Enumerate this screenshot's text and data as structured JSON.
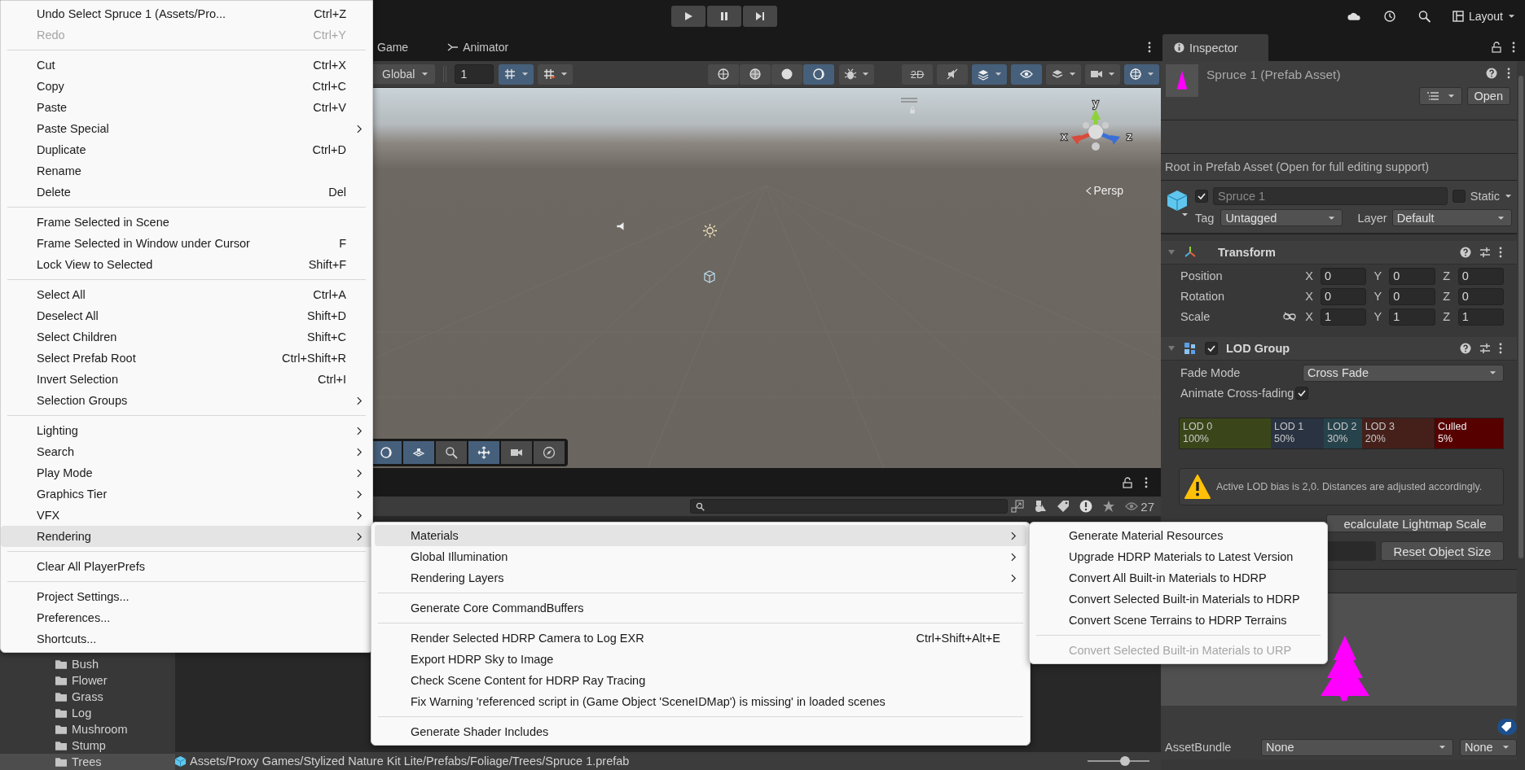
{
  "top_bar": {
    "layout_label": "Layout"
  },
  "scene_tabs": [
    {
      "label": "Game"
    },
    {
      "label": "Animator"
    }
  ],
  "scene_toolbar": {
    "pivot_label": "Global",
    "grid_value": "1",
    "groups": [
      [
        {
          "kind": "grid",
          "on": true
        },
        {
          "kind": "snap",
          "on": false
        }
      ],
      [
        {
          "kind": "wire",
          "on": false
        },
        {
          "kind": "shaded-wire",
          "on": false
        },
        {
          "kind": "shaded",
          "on": false
        },
        {
          "kind": "unlit",
          "on": true
        }
      ],
      [
        {
          "kind": "debug",
          "on": false
        }
      ],
      [
        {
          "kind": "flat",
          "on": false,
          "label": "2D"
        },
        {
          "kind": "audio",
          "on": false
        },
        {
          "kind": "effects",
          "on": true
        },
        {
          "kind": "visibility",
          "on": true
        },
        {
          "kind": "layers",
          "on": false
        },
        {
          "kind": "camera",
          "on": false
        },
        {
          "kind": "gizmos",
          "on": true
        }
      ]
    ]
  },
  "scene_view": {
    "camera_label": "Persp",
    "axes": [
      "y",
      "x",
      "z"
    ],
    "overlay_tools": [
      {
        "kind": "unlit",
        "on": true
      },
      {
        "kind": "tiles",
        "on": true
      },
      {
        "kind": "search",
        "on": false
      },
      {
        "kind": "move",
        "on": true
      },
      {
        "kind": "camera",
        "on": false
      },
      {
        "kind": "compass",
        "on": false
      }
    ]
  },
  "project": {
    "count": "27",
    "folders": [
      {
        "label": "Bush",
        "selected": false
      },
      {
        "label": "Flower",
        "selected": false
      },
      {
        "label": "Grass",
        "selected": false
      },
      {
        "label": "Log",
        "selected": false
      },
      {
        "label": "Mushroom",
        "selected": false
      },
      {
        "label": "Stump",
        "selected": false
      },
      {
        "label": "Trees",
        "selected": true
      }
    ],
    "path": "Assets/Proxy Games/Stylized Nature Kit Lite/Prefabs/Foliage/Trees/Spruce 1.prefab",
    "zoom_slider": {
      "level": 0.6
    }
  },
  "inspector": {
    "tab": "Inspector",
    "asset_title": "Spruce 1 (Prefab Asset)",
    "open_button": "Open",
    "notice": "Root in Prefab Asset (Open for full editing support)",
    "object": {
      "active": true,
      "name": "Spruce 1",
      "static": false,
      "static_label": "Static",
      "tag_label": "Tag",
      "tag": "Untagged",
      "layer_label": "Layer",
      "layer": "Default"
    },
    "transform": {
      "title": "Transform",
      "rows": [
        {
          "label": "Position",
          "values": [
            {
              "axis": "X",
              "value": "0"
            },
            {
              "axis": "Y",
              "value": "0"
            },
            {
              "axis": "Z",
              "value": "0"
            }
          ]
        },
        {
          "label": "Rotation",
          "values": [
            {
              "axis": "X",
              "value": "0"
            },
            {
              "axis": "Y",
              "value": "0"
            },
            {
              "axis": "Z",
              "value": "0"
            }
          ]
        },
        {
          "label": "Scale",
          "values": [
            {
              "axis": "X",
              "value": "1"
            },
            {
              "axis": "Y",
              "value": "1"
            },
            {
              "axis": "Z",
              "value": "1"
            }
          ]
        }
      ]
    },
    "lod_group": {
      "title": "LOD Group",
      "enabled": true,
      "fade_mode_label": "Fade Mode",
      "fade_mode": "Cross Fade",
      "animate_label": "Animate Cross-fading",
      "animate": true,
      "levels": [
        {
          "name": "LOD 0",
          "percent": "100%",
          "color": "#3a4619"
        },
        {
          "name": "LOD 1",
          "percent": "50%",
          "color": "#2a3342"
        },
        {
          "name": "LOD 2",
          "percent": "30%",
          "color": "#26424b"
        },
        {
          "name": "LOD 3",
          "percent": "20%",
          "color": "#45201a"
        },
        {
          "name": "Culled",
          "percent": "5%",
          "color": "#560000"
        }
      ],
      "warning": "Active LOD bias is 2,0. Distances are adjusted accordingly.",
      "recalculate_button": "ecalculate Lightmap Scale",
      "reset_button": "Reset Object Size"
    },
    "asset_bundle": {
      "label": "AssetBundle",
      "name": "None",
      "variant": "None"
    }
  },
  "menus": [
    {
      "items": [
        {
          "kind": "item",
          "label": "Undo Select Spruce 1 (Assets/Pro...",
          "shortcut": "Ctrl+Z",
          "disabled": false,
          "selected": false
        },
        {
          "kind": "item",
          "label": "Redo",
          "shortcut": "Ctrl+Y",
          "disabled": true,
          "selected": false
        },
        {
          "kind": "separator"
        },
        {
          "kind": "item",
          "label": "Cut",
          "shortcut": "Ctrl+X",
          "disabled": false,
          "selected": false
        },
        {
          "kind": "item",
          "label": "Copy",
          "shortcut": "Ctrl+C",
          "disabled": false,
          "selected": false
        },
        {
          "kind": "item",
          "label": "Paste",
          "shortcut": "Ctrl+V",
          "disabled": false,
          "selected": false
        },
        {
          "kind": "submenu",
          "label": "Paste Special",
          "disabled": false,
          "selected": false
        },
        {
          "kind": "item",
          "label": "Duplicate",
          "shortcut": "Ctrl+D",
          "disabled": false,
          "selected": false
        },
        {
          "kind": "item",
          "label": "Rename",
          "disabled": false,
          "selected": false
        },
        {
          "kind": "item",
          "label": "Delete",
          "shortcut": "Del",
          "disabled": false,
          "selected": false
        },
        {
          "kind": "separator"
        },
        {
          "kind": "item",
          "label": "Frame Selected in Scene",
          "disabled": false,
          "selected": false
        },
        {
          "kind": "item",
          "label": "Frame Selected in Window under Cursor",
          "shortcut": "F",
          "disabled": false,
          "selected": false
        },
        {
          "kind": "item",
          "label": "Lock View to Selected",
          "shortcut": "Shift+F",
          "disabled": false,
          "selected": false
        },
        {
          "kind": "separator"
        },
        {
          "kind": "item",
          "label": "Select All",
          "shortcut": "Ctrl+A",
          "disabled": false,
          "selected": false
        },
        {
          "kind": "item",
          "label": "Deselect All",
          "shortcut": "Shift+D",
          "disabled": false,
          "selected": false
        },
        {
          "kind": "item",
          "label": "Select Children",
          "shortcut": "Shift+C",
          "disabled": false,
          "selected": false
        },
        {
          "kind": "item",
          "label": "Select Prefab Root",
          "shortcut": "Ctrl+Shift+R",
          "disabled": false,
          "selected": false
        },
        {
          "kind": "item",
          "label": "Invert Selection",
          "shortcut": "Ctrl+I",
          "disabled": false,
          "selected": false
        },
        {
          "kind": "submenu",
          "label": "Selection Groups",
          "disabled": false,
          "selected": false
        },
        {
          "kind": "separator"
        },
        {
          "kind": "submenu",
          "label": "Lighting",
          "disabled": false,
          "selected": false
        },
        {
          "kind": "submenu",
          "label": "Search",
          "disabled": false,
          "selected": false
        },
        {
          "kind": "submenu",
          "label": "Play Mode",
          "disabled": false,
          "selected": false
        },
        {
          "kind": "submenu",
          "label": "Graphics Tier",
          "disabled": false,
          "selected": false
        },
        {
          "kind": "submenu",
          "label": "VFX",
          "disabled": false,
          "selected": false
        },
        {
          "kind": "submenu",
          "label": "Rendering",
          "disabled": false,
          "selected": true
        },
        {
          "kind": "separator"
        },
        {
          "kind": "item",
          "label": "Clear All PlayerPrefs",
          "disabled": false,
          "selected": false
        },
        {
          "kind": "separator"
        },
        {
          "kind": "item",
          "label": "Project Settings...",
          "disabled": false,
          "selected": false
        },
        {
          "kind": "item",
          "label": "Preferences...",
          "disabled": false,
          "selected": false
        },
        {
          "kind": "item",
          "label": "Shortcuts...",
          "disabled": false,
          "selected": false
        }
      ]
    },
    {
      "items": [
        {
          "kind": "submenu",
          "label": "Materials",
          "disabled": false,
          "selected": true
        },
        {
          "kind": "submenu",
          "label": "Global Illumination",
          "disabled": false,
          "selected": false
        },
        {
          "kind": "submenu",
          "label": "Rendering Layers",
          "disabled": false,
          "selected": false
        },
        {
          "kind": "separator"
        },
        {
          "kind": "item",
          "label": "Generate Core CommandBuffers",
          "disabled": false,
          "selected": false
        },
        {
          "kind": "separator"
        },
        {
          "kind": "item",
          "label": "Render Selected HDRP Camera to Log EXR",
          "shortcut": "Ctrl+Shift+Alt+E",
          "disabled": false,
          "selected": false
        },
        {
          "kind": "item",
          "label": "Export HDRP Sky to Image",
          "disabled": false,
          "selected": false
        },
        {
          "kind": "item",
          "label": "Check Scene Content for HDRP Ray Tracing",
          "disabled": false,
          "selected": false
        },
        {
          "kind": "item",
          "label": "Fix Warning 'referenced script in (Game Object 'SceneIDMap') is missing' in loaded scenes",
          "disabled": false,
          "selected": false
        },
        {
          "kind": "separator"
        },
        {
          "kind": "item",
          "label": "Generate Shader Includes",
          "disabled": false,
          "selected": false
        }
      ]
    },
    {
      "items": [
        {
          "kind": "item",
          "label": "Generate Material Resources",
          "disabled": false,
          "selected": false
        },
        {
          "kind": "item",
          "label": "Upgrade HDRP Materials to Latest Version",
          "disabled": false,
          "selected": false
        },
        {
          "kind": "item",
          "label": "Convert All Built-in Materials to HDRP",
          "disabled": false,
          "selected": false
        },
        {
          "kind": "item",
          "label": "Convert Selected Built-in Materials to HDRP",
          "disabled": false,
          "selected": false
        },
        {
          "kind": "item",
          "label": "Convert Scene Terrains to HDRP Terrains",
          "disabled": false,
          "selected": false
        },
        {
          "kind": "separator"
        },
        {
          "kind": "item",
          "label": "Convert Selected Built-in Materials to URP",
          "disabled": true,
          "selected": false
        }
      ]
    }
  ]
}
